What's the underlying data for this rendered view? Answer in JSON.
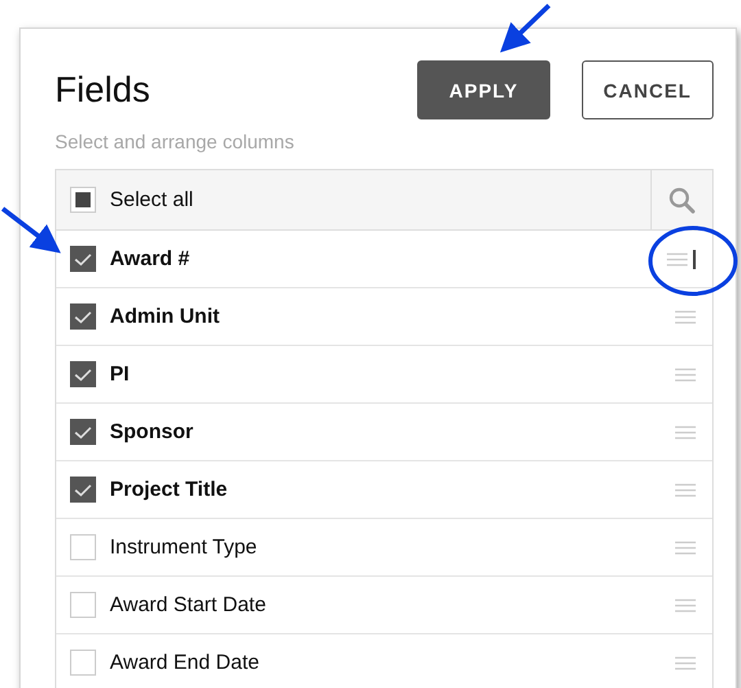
{
  "dialog": {
    "title": "Fields",
    "subtitle": "Select and arrange columns",
    "buttons": [
      {
        "label": "APPLY",
        "kind": "primary"
      },
      {
        "label": "CANCEL",
        "kind": "secondary"
      }
    ]
  },
  "select_all": {
    "label": "Select all",
    "indeterminate": true
  },
  "fields": [
    {
      "label": "Award #",
      "checked": true,
      "cursor": true
    },
    {
      "label": "Admin Unit",
      "checked": true
    },
    {
      "label": "PI",
      "checked": true
    },
    {
      "label": "Sponsor",
      "checked": true
    },
    {
      "label": "Project Title",
      "checked": true
    },
    {
      "label": "Instrument Type",
      "checked": false
    },
    {
      "label": "Award Start Date",
      "checked": false
    },
    {
      "label": "Award End Date",
      "checked": false
    }
  ]
}
